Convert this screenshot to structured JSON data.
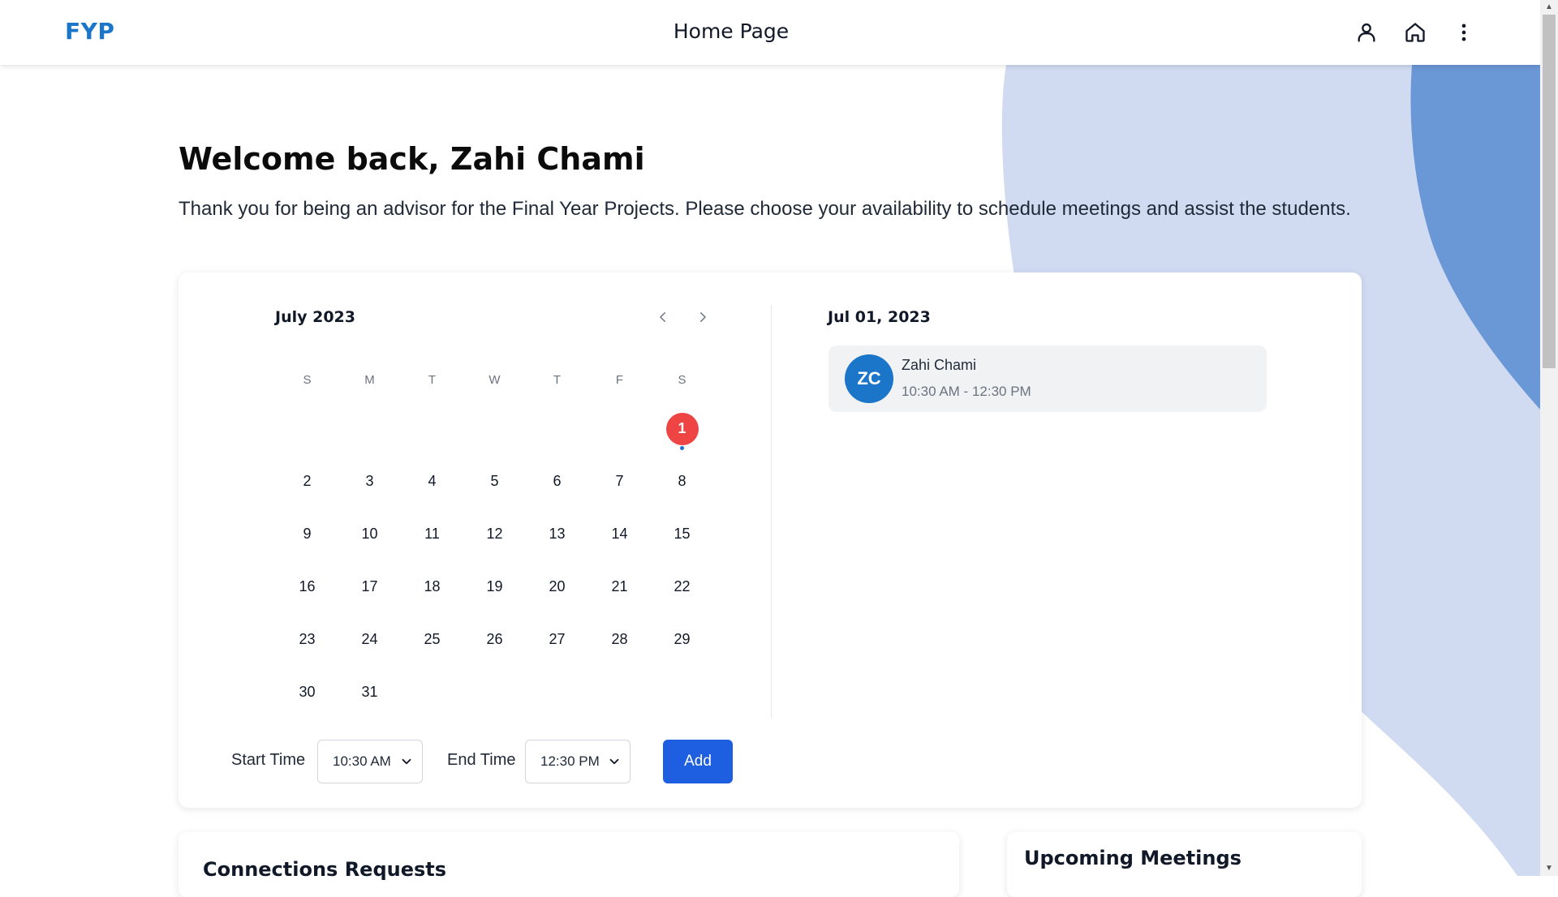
{
  "header": {
    "logo": "FYP",
    "title": "Home Page",
    "icons": [
      "user-icon",
      "home-icon",
      "more-vertical-icon"
    ]
  },
  "welcome": {
    "title": "Welcome back, Zahi Chami",
    "subtitle": "Thank you for being an advisor for the Final Year Projects. Please choose your availability to schedule meetings and assist the students."
  },
  "calendar": {
    "month_label": "July 2023",
    "weekdays": [
      "S",
      "M",
      "T",
      "W",
      "T",
      "F",
      "S"
    ],
    "leading_blanks": 6,
    "days": [
      "1",
      "2",
      "3",
      "4",
      "5",
      "6",
      "7",
      "8",
      "9",
      "10",
      "11",
      "12",
      "13",
      "14",
      "15",
      "16",
      "17",
      "18",
      "19",
      "20",
      "21",
      "22",
      "23",
      "24",
      "25",
      "26",
      "27",
      "28",
      "29",
      "30",
      "31"
    ],
    "selected_day": "1",
    "days_with_events": [
      "1"
    ]
  },
  "schedule": {
    "date_label": "Jul 01, 2023",
    "meetings": [
      {
        "initials": "ZC",
        "name": "Zahi Chami",
        "time": "10:30 AM - 12:30 PM"
      }
    ]
  },
  "form": {
    "start_label": "Start Time",
    "start_value": "10:30 AM",
    "end_label": "End Time",
    "end_value": "12:30 PM",
    "add_label": "Add"
  },
  "sections": {
    "connections_title": "Connections Requests",
    "upcoming_title": "Upcoming Meetings"
  },
  "colors": {
    "brand": "#1b75c9",
    "selected_day": "#ef4444",
    "primary_button": "#1d5fe0",
    "bg_light_blue": "#d0dbf2",
    "bg_mid_blue": "#6a97d6"
  }
}
